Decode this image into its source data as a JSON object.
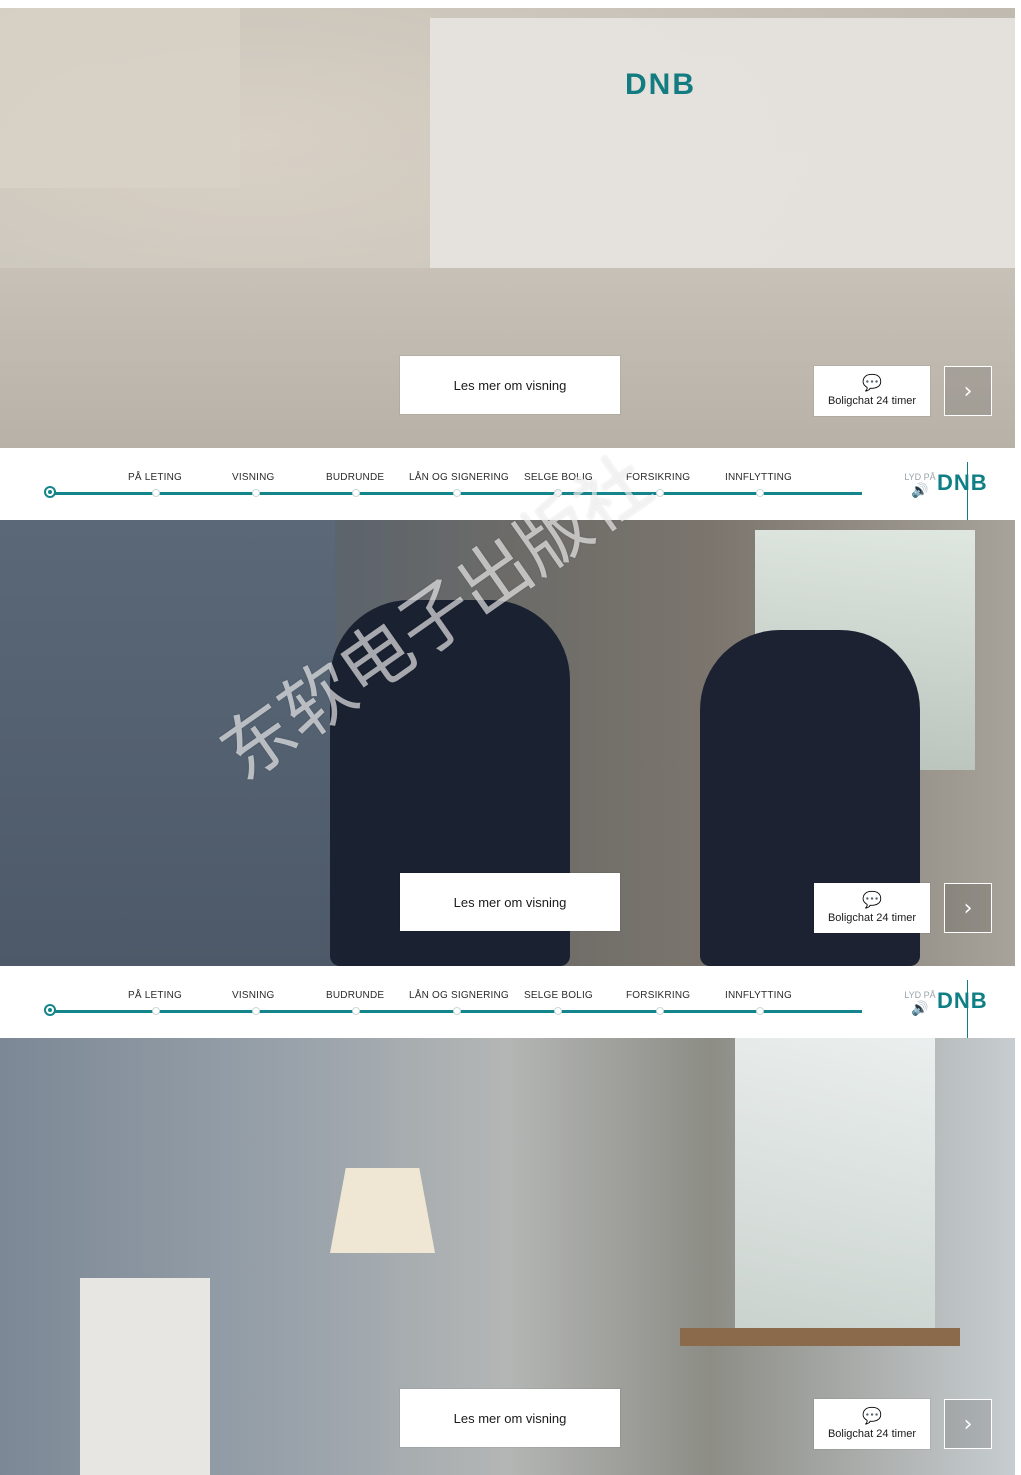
{
  "screens": [
    {
      "cta_label": "Les mer om visning",
      "chat_label": "Boligchat 24 timer",
      "next_icon": "chevron-right",
      "scene_brand": "DNB"
    },
    {
      "cta_label": "Les mer om visning",
      "chat_label": "Boligchat 24 timer",
      "next_icon": "chevron-right"
    },
    {
      "cta_label": "Les mer om visning",
      "chat_label": "Boligchat 24 timer",
      "next_icon": "chevron-right"
    }
  ],
  "timeline": {
    "steps": [
      "PÅ LETING",
      "VISNING",
      "BUDRUNDE",
      "LÅN OG SIGNERING",
      "SELGE BOLIG",
      "FORSIKRING",
      "INNFLYTTING"
    ],
    "sound_label": "LYD PÅ",
    "brand_logo": "DNB"
  },
  "watermark": "东软电子出版社",
  "colors": {
    "accent": "#13858B",
    "logo": "#0F7F86"
  }
}
